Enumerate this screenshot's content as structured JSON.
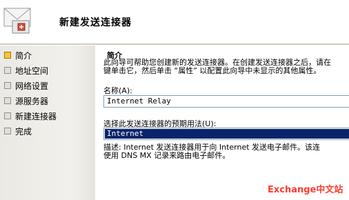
{
  "window": {
    "title": "新建发送连接器"
  },
  "sidebar": {
    "items": [
      {
        "label": "简介",
        "active": true
      },
      {
        "label": "地址空间",
        "active": false
      },
      {
        "label": "网络设置",
        "active": false
      },
      {
        "label": "源服务器",
        "active": false
      },
      {
        "label": "新建连接器",
        "active": false
      },
      {
        "label": "完成",
        "active": false
      }
    ]
  },
  "main": {
    "section_title": "简介",
    "description_line1": "此向导可帮助您创建新的发送连接器。在创建发送连接器之后，请在",
    "description_line2": "键单击它，然后单击 “属性” 以配置此向导中未显示的其他属性。",
    "name_label": "名称(A):",
    "name_value": "Internet Relay",
    "usage_label": "选择此发送连接器的预期用法(U):",
    "usage_selected": "Internet",
    "usage_desc_line1": "描述: Internet 发送连接器用于向 Internet 发送电子邮件。该连",
    "usage_desc_line2": "使用 DNS MX 记录来路由电子邮件。"
  },
  "watermark": "Exchange中文站",
  "colors": {
    "selection": "#0a246a",
    "active_step": "#f2c733",
    "watermark": "#ff3b30"
  }
}
